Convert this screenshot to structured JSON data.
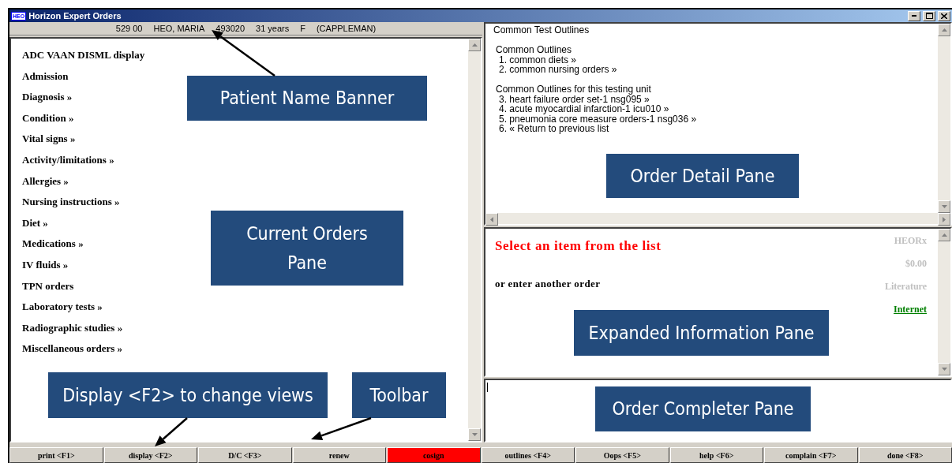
{
  "window": {
    "title": "Horizon Expert Orders",
    "logo": "HEO"
  },
  "banner": [
    "529 00",
    "HEO, MARIA",
    "493020",
    "31 years",
    "F",
    "(CAPPLEMAN)"
  ],
  "order_categories": [
    "ADC VAAN DISML display",
    "Admission",
    "Diagnosis »",
    "Condition »",
    "Vital signs »",
    "Activity/limitations »",
    "Allergies »",
    "Nursing instructions »",
    "Diet »",
    "Medications »",
    "IV fluids »",
    "TPN orders",
    "Laboratory tests »",
    "Radiographic studies »",
    "Miscellaneous orders »"
  ],
  "order_detail": {
    "heading": "Common Test Outlines",
    "groups": [
      {
        "title": "Common Outlines",
        "items": [
          "1. common diets  »",
          "2. common nursing orders  »"
        ]
      },
      {
        "title": "Common Outlines for this testing unit",
        "items": [
          "3. heart failure order set-1 nsg095  »",
          "4. acute myocardial infarction-1 icu010  »",
          "5. pneumonia core measure orders-1 nsg036  »",
          "6. « Return to previous list"
        ]
      }
    ]
  },
  "expanded_info": {
    "prompt": "Select an item from the list",
    "subprompt": "or enter another order",
    "links": [
      {
        "label": "HEORx",
        "disabled": true
      },
      {
        "label": "$0.00",
        "disabled": true
      },
      {
        "label": "Literature",
        "disabled": true
      },
      {
        "label": "Internet",
        "disabled": false
      }
    ]
  },
  "toolbar": [
    {
      "label": "print <F1>",
      "highlighted": false
    },
    {
      "label": "display <F2>",
      "highlighted": false
    },
    {
      "label": "D/C <F3>",
      "highlighted": false
    },
    {
      "label": "renew",
      "highlighted": false
    },
    {
      "label": "cosign",
      "highlighted": true
    },
    {
      "label": "outlines <F4>",
      "highlighted": false
    },
    {
      "label": "Oops <F5>",
      "highlighted": false
    },
    {
      "label": "help <F6>",
      "highlighted": false
    },
    {
      "label": "complain <F7>",
      "highlighted": false
    },
    {
      "label": "done <F8>",
      "highlighted": false
    }
  ],
  "callouts": [
    {
      "label": "Patient Name Banner"
    },
    {
      "label": "Current Orders Pane"
    },
    {
      "label": "Order Detail Pane"
    },
    {
      "label": "Expanded Information Pane"
    },
    {
      "label": "Display <F2> to change views"
    },
    {
      "label": "Toolbar"
    },
    {
      "label": "Order Completer Pane"
    }
  ]
}
